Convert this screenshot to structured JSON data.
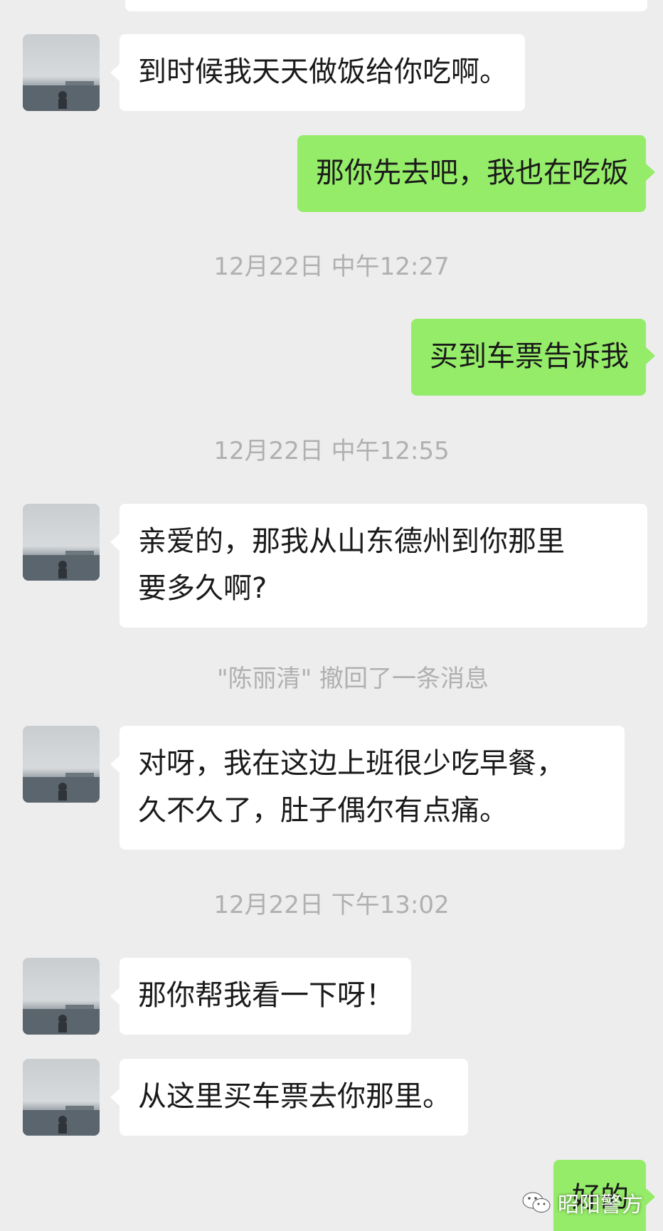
{
  "messages": [
    {
      "side": "left",
      "text": "到时候我天天做饭给你吃啊。"
    },
    {
      "side": "right",
      "text": "那你先去吧，我也在吃饭"
    },
    {
      "side": "right",
      "text": "买到车票告诉我"
    },
    {
      "side": "left",
      "text": "亲爱的，那我从山东德州到你那里\n要多久啊?"
    },
    {
      "side": "left",
      "text": "对呀，我在这边上班很少吃早餐，\n久不久了，肚子偶尔有点痛。"
    },
    {
      "side": "left",
      "text": "那你帮我看一下呀！"
    },
    {
      "side": "left",
      "text": "从这里买车票去你那里。"
    },
    {
      "side": "right",
      "text": "好的"
    }
  ],
  "timestamps": [
    "12月22日 中午12:27",
    "12月22日 中午12:55",
    "12月22日 下午13:02"
  ],
  "recall_notice": "\"陈丽清\" 撤回了一条消息",
  "watermark": {
    "text": "昭阳警方",
    "icon": "wechat-icon"
  },
  "colors": {
    "background": "#ededed",
    "incoming_bubble": "#ffffff",
    "outgoing_bubble": "#95ec69",
    "system_text": "#b0b0b0"
  }
}
